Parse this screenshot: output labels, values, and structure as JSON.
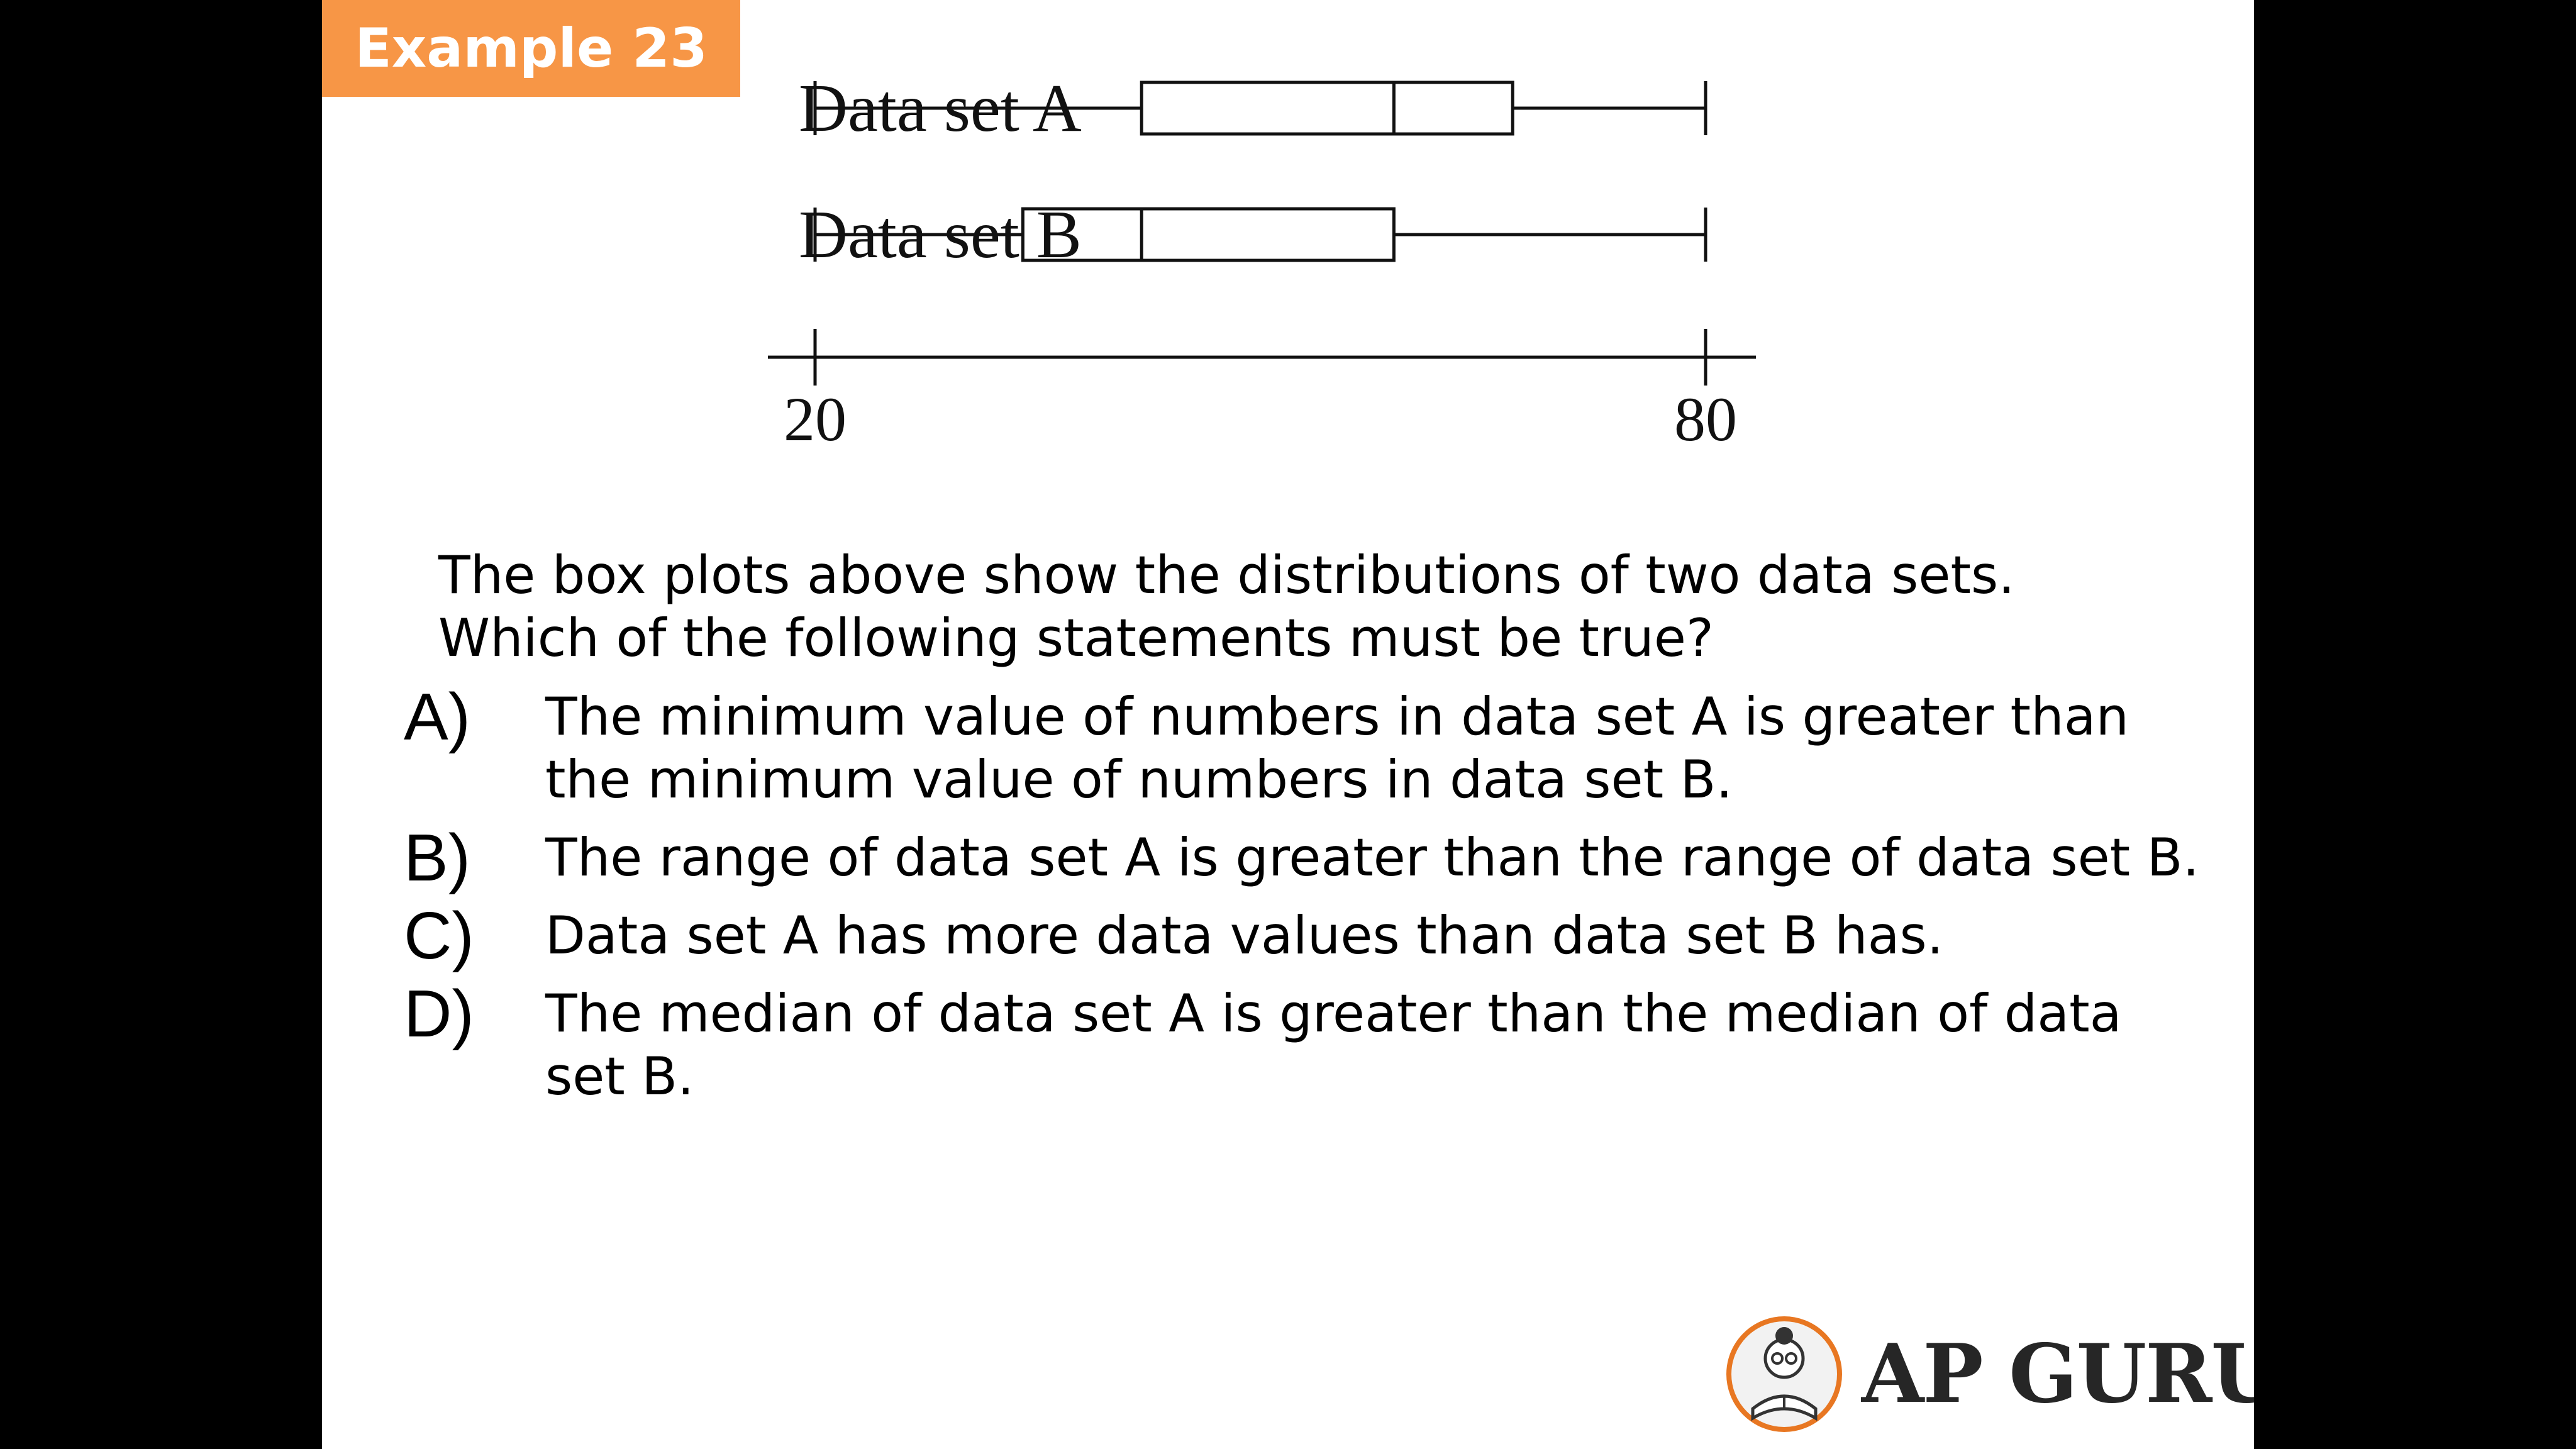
{
  "badge": {
    "label": "Example 23"
  },
  "colors": {
    "badge_bg": "#f79646",
    "ink": "#111111",
    "page_bg": "#ffffff",
    "logo_ring": "#e87722"
  },
  "chart_data": {
    "type": "boxplot",
    "axis": {
      "xlim": [
        20,
        80
      ],
      "ticks": [
        20,
        80
      ],
      "tick_labels": [
        "20",
        "80"
      ]
    },
    "series": [
      {
        "name": "Data set A",
        "min": 20,
        "q1": 42,
        "median": 59,
        "q3": 67,
        "max": 80
      },
      {
        "name": "Data set B",
        "min": 20,
        "q1": 34,
        "median": 42,
        "q3": 59,
        "max": 80
      }
    ]
  },
  "question": {
    "line1": "The box plots above show the distributions of two data sets.",
    "line2": "Which of the following statements must be true?"
  },
  "choices": [
    {
      "letter": "A)",
      "text": "The minimum value of numbers in data set A is greater than the minimum value of numbers in data set B."
    },
    {
      "letter": "B)",
      "text": "The range of data set A is greater than the range of data set B."
    },
    {
      "letter": "C)",
      "text": "Data set A has more data values than data set B has."
    },
    {
      "letter": "D)",
      "text": "The median of data set A is greater than the median of data set B."
    }
  ],
  "logo": {
    "text": "AP GURU",
    "icon": "reading-guru-icon"
  }
}
